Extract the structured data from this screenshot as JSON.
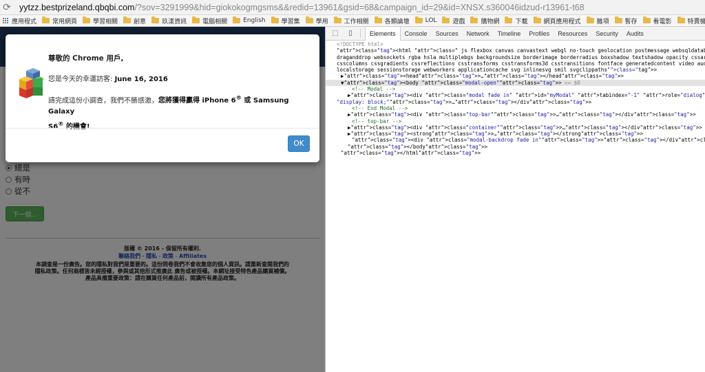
{
  "browser": {
    "url_host": "yytzz.bestprizeland.qbqbi.com",
    "url_path": "/?sov=3291999&hid=giokokogmgsms&&redid=13961&gsid=68&campaign_id=29&id=XNSX.s360046idzud-r13961-t68",
    "bookmarks": [
      "應用程式",
      "常用網頁",
      "學習相關",
      "創意",
      "玖漾資訊",
      "電腦相關",
      "English",
      "學習集",
      "學用",
      "工作相關",
      "各類論壇",
      "LOL",
      "遊戲",
      "購物網",
      "下載",
      "網頁應用程式",
      "雜項",
      "暫存",
      "看電影",
      "特賣機器器運入 VMw"
    ]
  },
  "page": {
    "options": [
      "總是",
      "有時",
      "從不"
    ],
    "next_button": "下一個...",
    "footer": {
      "copyright": "版權 © 2016 - 保留所有權利.",
      "links": [
        "聯絡我們",
        "隱私",
        "政策",
        "Affiliates"
      ],
      "disclaimer_1": "本調查是一份廣告。您的隱私對我們是重要的。這份問卷我們不會收集您的個人資訊。請重新查閱我們的",
      "disclaimer_2": "隱私政策。任何商標皆未經授權，參與或其他形式推廣此 廣告或被授權。本網址接受特色產品購買補償。",
      "disclaimer_3": "產品具備重要政策：請在購買任何產品前，閱讀所有產品政策。"
    }
  },
  "modal": {
    "greeting": "尊敬的 Chrome 用戶,",
    "lucky_prefix": "您是今天的幸運訪客: ",
    "lucky_date": "June 16, 2016",
    "survey_prefix": "請完成這份小調查，我們不勝感激，",
    "survey_bold": "您將獲得贏得 iPhone 6",
    "survey_or": " 或 Samsung Galaxy",
    "survey_end_bold": "S6",
    "survey_tail": " 的機會!",
    "reg": "®",
    "ok_label": "OK"
  },
  "devtools": {
    "tabs": [
      "Elements",
      "Console",
      "Sources",
      "Network",
      "Timeline",
      "Profiles",
      "Resources",
      "Security",
      "Audits"
    ],
    "active_tab": "Elements",
    "lines": [
      "<!DOCTYPE html>",
      "<html class=\" js flexbox canvas canvastext webgl no-touch geolocation postmessage websqldatabase indexeddb hashchange",
      "draganddrop websockets rgba hsla multiplebgs backgroundsize borderimage borderradius boxshadow textshadow opacity cssar",
      "csscolumns cssgradients cssreflections csstransforms csstransforms3d csstransitions fontface generatedcontent video aud",
      "localstorage sessionstorage webworkers applicationcache svg inlinesvg smil svgclippaths\">",
      "▶<head>…</head>",
      "▼<body class=\"modal-open\"> == $0",
      "<!-- Modal -->",
      "▶<div class=\"modal fade in\" id=\"myModal\" tabindex=\"-1\" role=\"dialog\" aria-labelledby=\"myModalLabel\" aria-hidden=\"fa",
      "\"display: block;\">…</div>",
      "<!-- End Modal -->",
      "▶<div class=\"top-bar\">…</div>",
      "<!-- top-bar -->",
      "▶<div class=\"container\">…</div>",
      "▶<strong>…</strong>",
      "<div class=\"modal-backdrop fade in\"></div>",
      "</body>",
      "</html>"
    ]
  },
  "colors": {
    "topbar": "#1e3d63",
    "ok_button": "#428bca",
    "next_button": "#5cb85c",
    "backdrop": "rgba(0,0,0,0.5)"
  }
}
